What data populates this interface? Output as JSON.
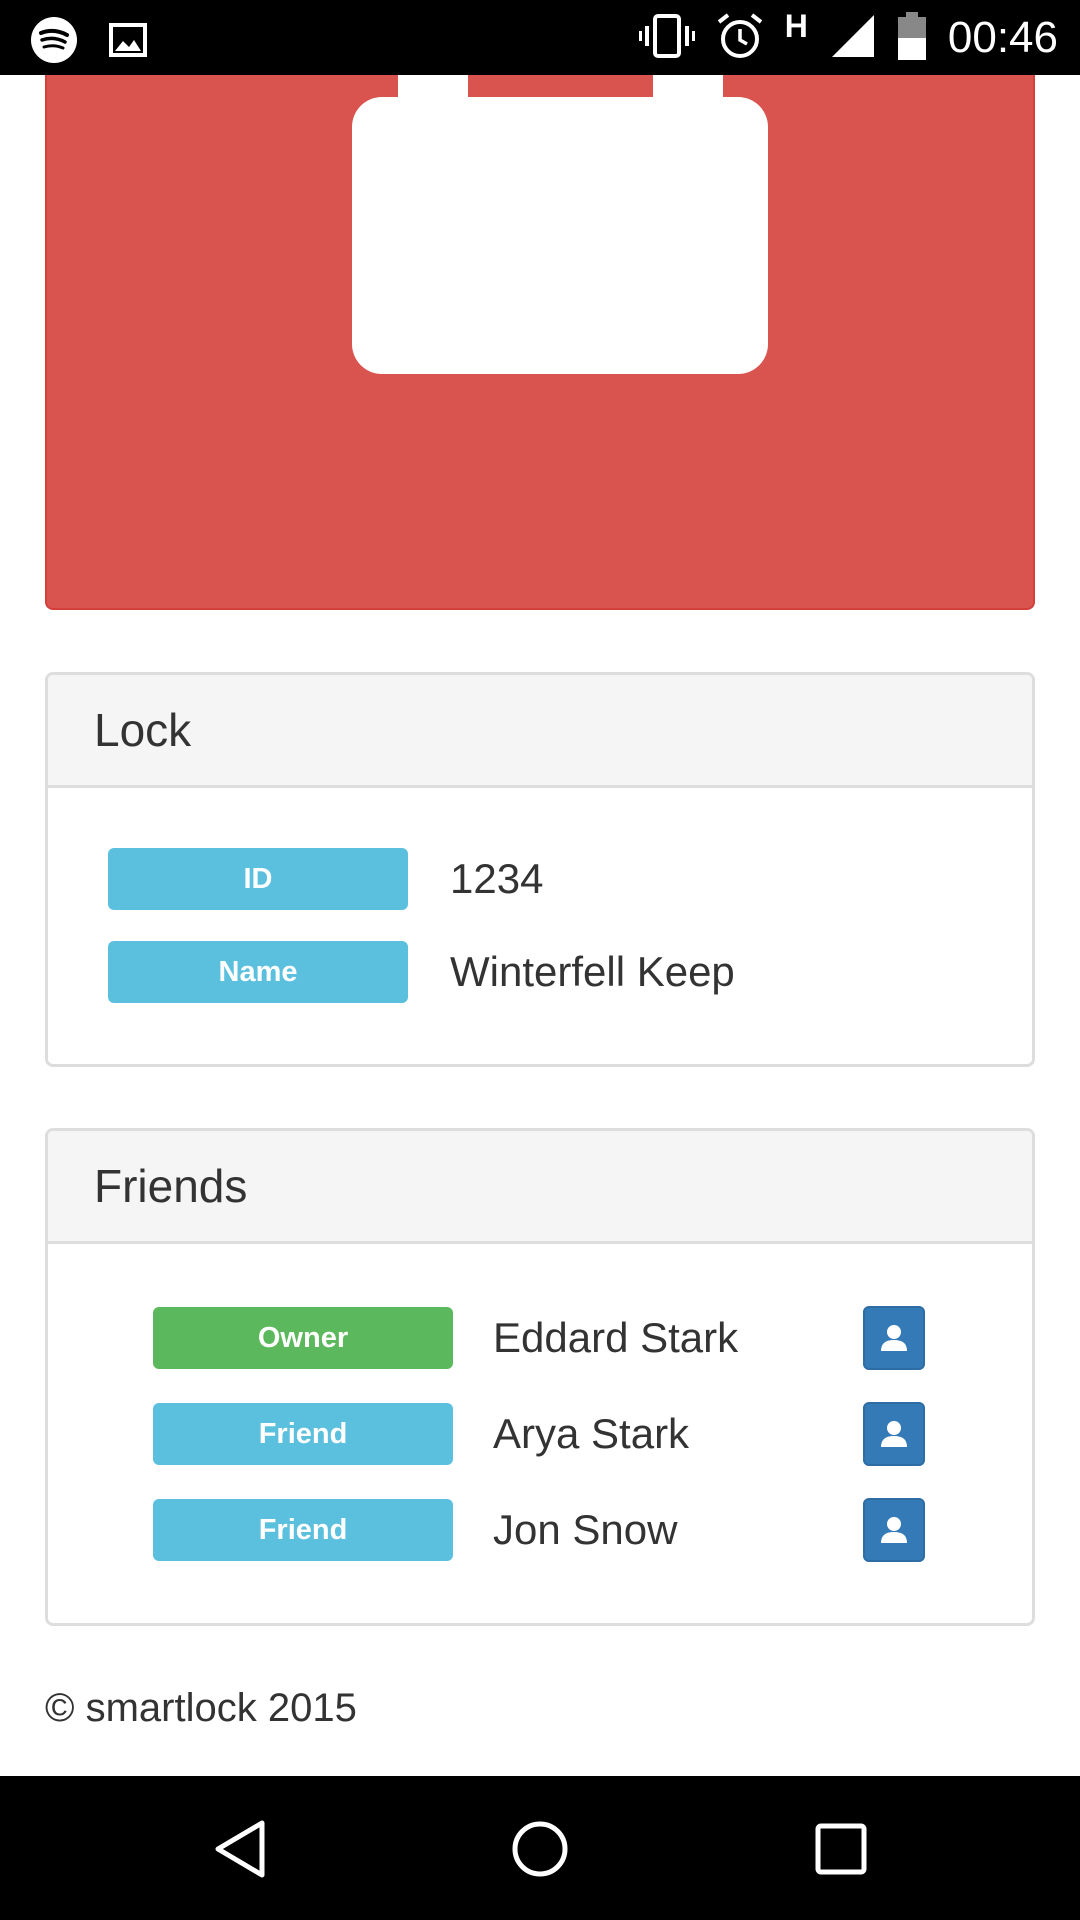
{
  "status_bar": {
    "time": "00:46",
    "network_type": "H",
    "icons": [
      "spotify-icon",
      "image-icon",
      "vibrate-icon",
      "alarm-icon",
      "signal-icon",
      "battery-icon"
    ]
  },
  "lock_banner": {
    "state_color": "#d9534f",
    "icon": "padlock-icon"
  },
  "lock_panel": {
    "title": "Lock",
    "rows": [
      {
        "label": "ID",
        "value": "1234"
      },
      {
        "label": "Name",
        "value": "Winterfell Keep"
      }
    ]
  },
  "friends_panel": {
    "title": "Friends",
    "rows": [
      {
        "role": "Owner",
        "name": "Eddard Stark",
        "role_color": "#5cb85c",
        "action_icon": "user-icon"
      },
      {
        "role": "Friend",
        "name": "Arya Stark",
        "role_color": "#5bc0de",
        "action_icon": "user-icon"
      },
      {
        "role": "Friend",
        "name": "Jon Snow",
        "role_color": "#5bc0de",
        "action_icon": "user-icon"
      }
    ]
  },
  "footer": {
    "text": "© smartlock 2015"
  },
  "nav_bar": {
    "buttons": [
      "back-icon",
      "home-icon",
      "recents-icon"
    ]
  }
}
